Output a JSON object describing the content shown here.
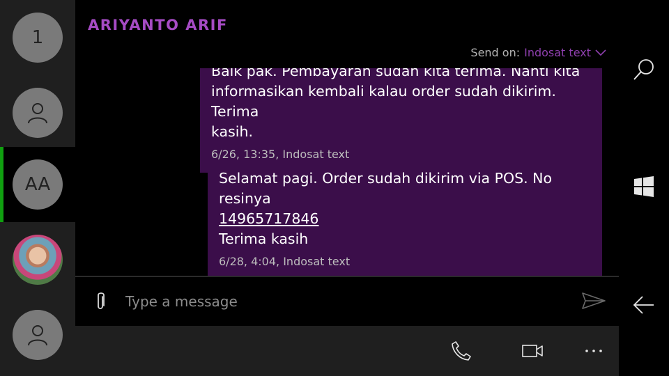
{
  "conversations": [
    {
      "avatar_text": "1",
      "type": "text"
    },
    {
      "avatar_text": "",
      "type": "person-icon"
    },
    {
      "avatar_text": "AA",
      "type": "text",
      "active": true
    },
    {
      "avatar_text": "",
      "type": "photo"
    },
    {
      "avatar_text": "",
      "type": "person-icon"
    }
  ],
  "header": {
    "contact_name": "ARIYANTO ARIF",
    "send_on_label": "Send on:",
    "send_on_value": "Indosat text"
  },
  "messages": [
    {
      "text_line0": "Baik pak. Pembayaran sudah kita terima. Nanti kita",
      "text_line1": "informasikan kembali kalau order sudah dikirim. Terima",
      "text_line2": "kasih.",
      "meta": "6/26, 13:35, Indosat text"
    },
    {
      "text_line1": "Selamat pagi. Order sudah dikirim via POS. No resinya",
      "link": "14965717846",
      "text_line2": "Terima kasih",
      "meta": "6/28, 4:04, Indosat text"
    }
  ],
  "compose": {
    "placeholder": "Type a message"
  },
  "icons": {
    "accent": "#a64bc4",
    "bubble": "#3b0e4a",
    "active_indicator": "#10a010"
  }
}
